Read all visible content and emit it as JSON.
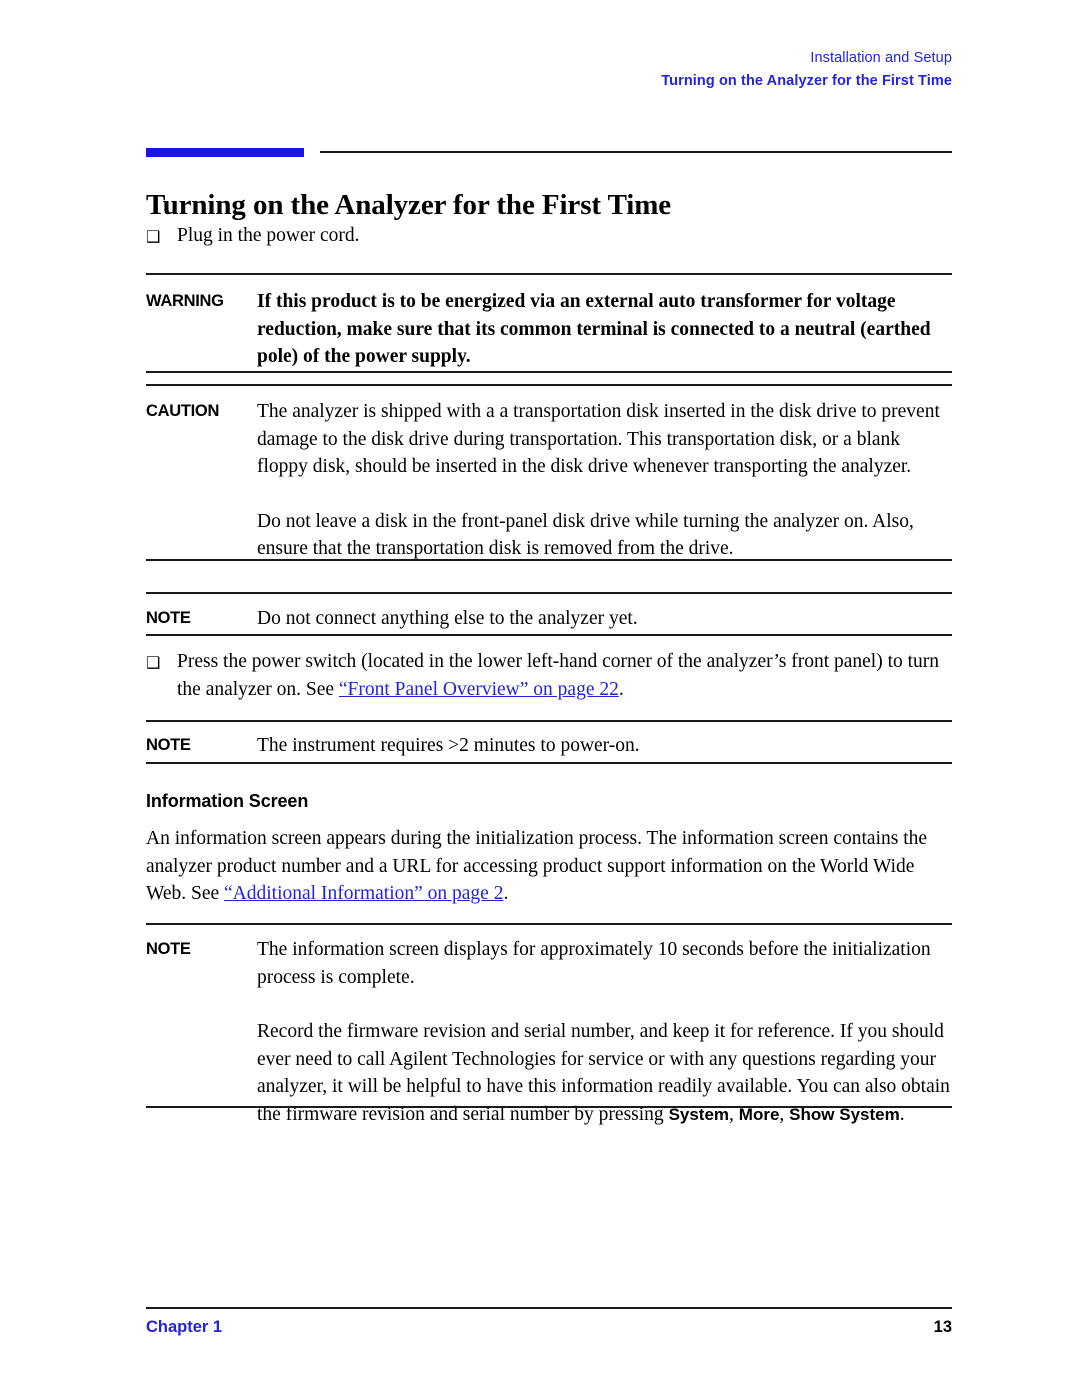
{
  "header": {
    "line1": "Installation and Setup",
    "line2": "Turning on the Analyzer for the First Time"
  },
  "title": "Turning on the Analyzer for the First Time",
  "accent_colors": {
    "blue_bar": "#1a14e0",
    "link_blue": "#2424d6",
    "rule_black": "#1a1a1a"
  },
  "bullets": {
    "glyph": "square-bullet-icon",
    "glyph_char": "❑",
    "item1": "Plug in the power cord.",
    "item2_before": "Press the power switch (located in the lower left-hand corner of the analyzer’s front panel) to turn the analyzer on. See ",
    "item2_link": "“Front Panel Overview” on page 22",
    "item2_after": "."
  },
  "warning": {
    "label": "WARNING",
    "body": "If this product is to be energized via an external auto transformer for voltage reduction, make sure that its common terminal is connected to a neutral (earthed pole) of the power supply."
  },
  "caution": {
    "label": "CAUTION",
    "body_p1": "The analyzer is shipped with a a transportation disk inserted in the disk drive to prevent damage to the disk drive during transportation. This transportation disk, or a blank floppy disk, should be inserted in the disk drive whenever transporting the analyzer.",
    "body_p2": "Do not leave a disk in the front-panel disk drive while turning the analyzer on. Also, ensure that the transportation disk is removed from the drive."
  },
  "note1": {
    "label": "NOTE",
    "body": "Do not connect anything else to the analyzer yet."
  },
  "note2": {
    "label": "NOTE",
    "body": "The instrument requires >2 minutes to power-on."
  },
  "section": {
    "subhead": "Information Screen",
    "para_before": "An information screen appears during the initialization process. The information screen contains the analyzer product number and a URL for accessing product support information on the World Wide Web. See ",
    "para_link": "“Additional Information” on page 2",
    "para_after": "."
  },
  "note3": {
    "label": "NOTE",
    "p1": "The information screen displays for approximately 10 seconds before the initialization process is complete.",
    "p2_before": "Record the firmware revision and serial number, and keep it for reference. If you should ever need to call Agilent Technologies for service or with any questions regarding your analyzer, it will be helpful to have this information readily available. You can also obtain the firmware revision and serial number by pressing ",
    "p2_key1": "System",
    "p2_sep1": ", ",
    "p2_key2": "More",
    "p2_sep2": ", ",
    "p2_key3": "Show System",
    "p2_after": "."
  },
  "footer": {
    "chapter": "Chapter 1",
    "page": "13"
  }
}
